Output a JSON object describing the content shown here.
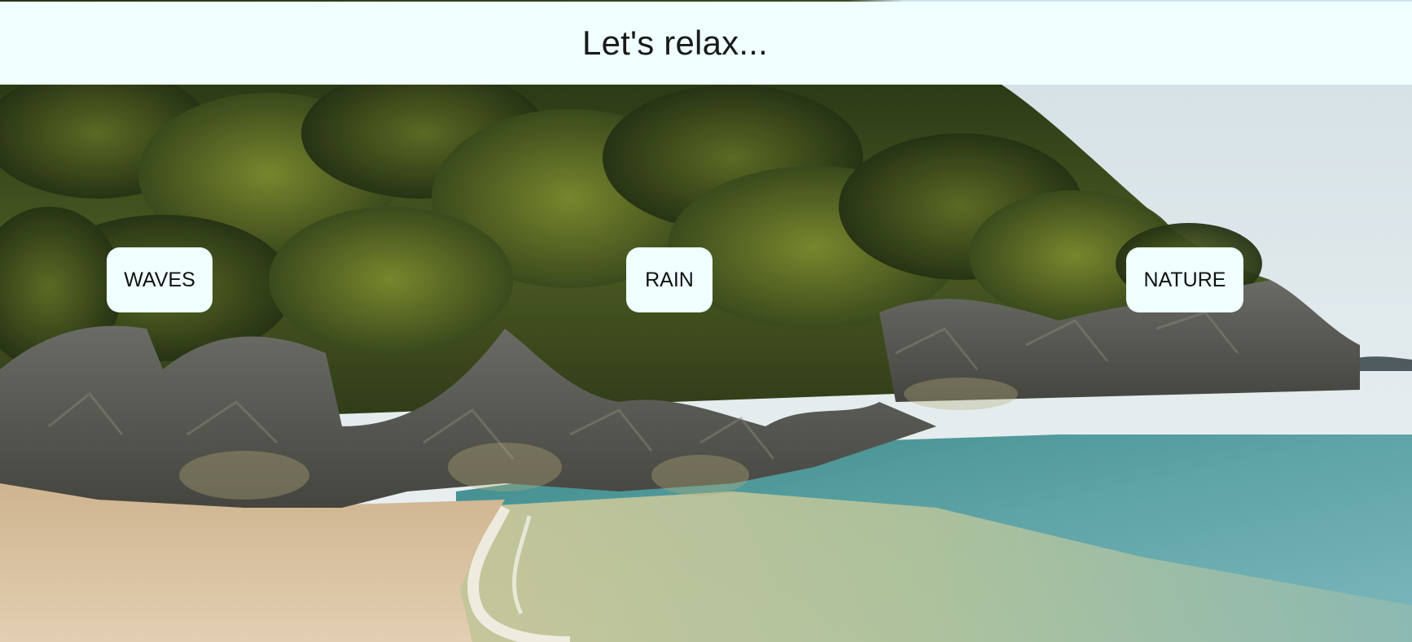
{
  "header": {
    "title": "Let's relax..."
  },
  "sounds": [
    {
      "label": "WAVES"
    },
    {
      "label": "RAIN"
    },
    {
      "label": "NATURE"
    }
  ],
  "background": {
    "colors": {
      "header_bg": "#f0ffff",
      "forest": "#3d4a1f",
      "rock": "#5a5a55",
      "sand": "#d9c3a0",
      "water": "#6aa6a8",
      "sky": "#dfe9ec"
    }
  }
}
